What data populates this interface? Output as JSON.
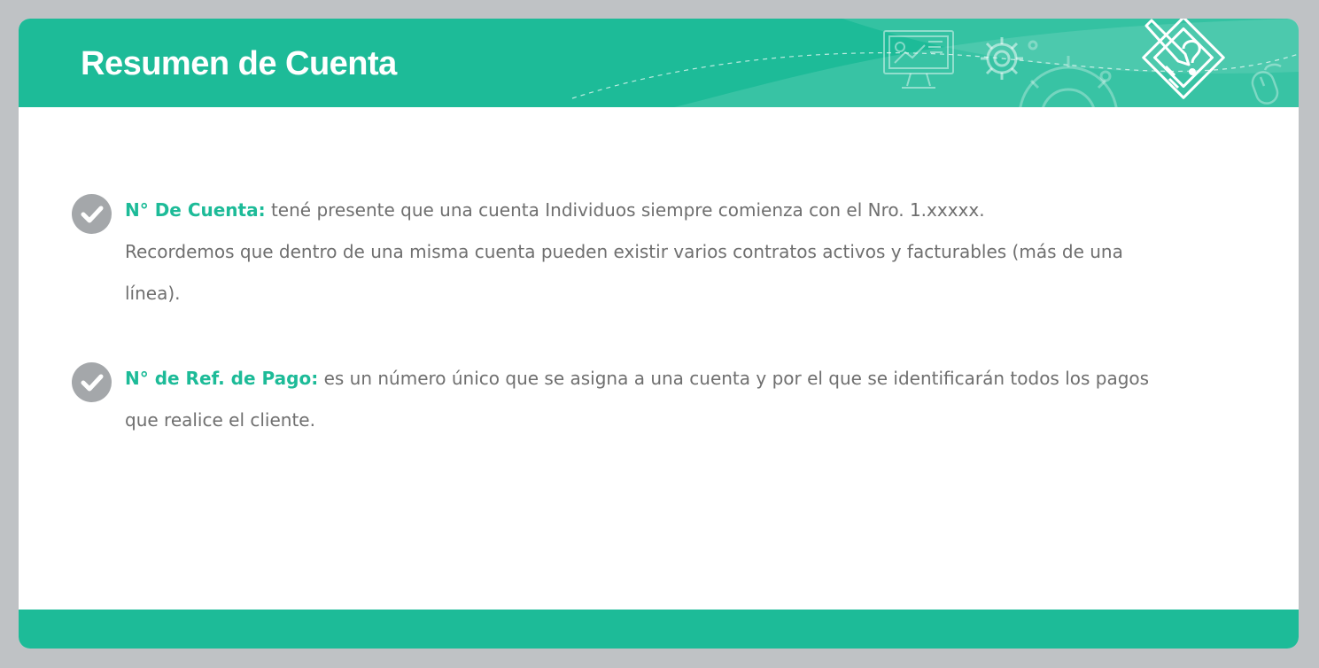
{
  "header": {
    "title": "Resumen de Cuenta",
    "icons": [
      "monitor-chart-icon",
      "gear-icon",
      "large-gear-icon",
      "pencil-question-icon",
      "mouse-icon"
    ]
  },
  "items": [
    {
      "icon": "check-icon",
      "label": "N° De Cuenta:",
      "text": "tené presente que una cuenta Individuos siempre comienza con el Nro. 1.xxxxx.",
      "continuation": "Recordemos que dentro de una misma cuenta pueden existir varios contratos activos y facturables (más de una línea)."
    },
    {
      "icon": "check-icon",
      "label": "N° de Ref. de Pago:",
      "text": "es un número único que se asigna a una cuenta y por el que se identificarán todos los pagos que realice el cliente.",
      "continuation": ""
    }
  ],
  "colors": {
    "accent": "#1dbb98",
    "background": "#bfc2c5",
    "body_text": "#6f6f6f",
    "check_bg": "#a4a7aa"
  }
}
